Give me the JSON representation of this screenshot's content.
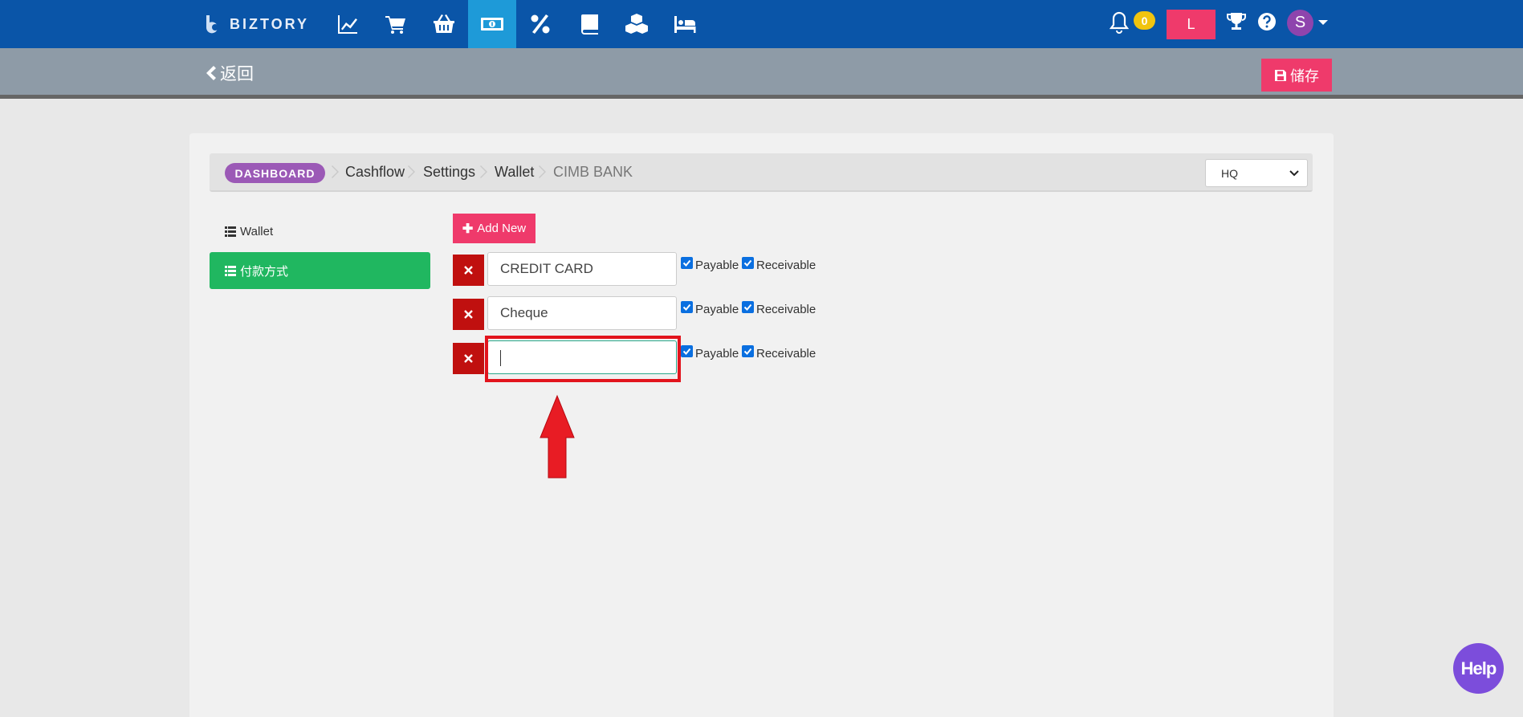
{
  "topnav": {
    "brand": "BIZTORY",
    "icons": [
      "chart-line-icon",
      "cart-icon",
      "basket-icon",
      "money-bill-icon",
      "percent-icon",
      "book-icon",
      "cubes-icon",
      "bed-icon"
    ],
    "active_icon": "money-bill-icon",
    "notification_count": "0",
    "location_button": "L",
    "avatar_letter": "S"
  },
  "subbar": {
    "back_label": "返回",
    "save_label": "储存"
  },
  "breadcrumb": {
    "dashboard": "DASHBOARD",
    "items": [
      "Cashflow",
      "Settings",
      "Wallet",
      "CIMB BANK"
    ]
  },
  "branch_select": {
    "selected": "HQ"
  },
  "sidebar": {
    "items": [
      {
        "label": "Wallet",
        "active": false
      },
      {
        "label": "付款方式",
        "active": true
      }
    ]
  },
  "main": {
    "add_new_label": "Add New",
    "payable_label": "Payable",
    "receivable_label": "Receivable",
    "methods": [
      {
        "value": "CREDIT CARD",
        "payable": true,
        "receivable": true
      },
      {
        "value": "Cheque",
        "payable": true,
        "receivable": true
      },
      {
        "value": "",
        "payable": true,
        "receivable": true,
        "focused": true
      }
    ]
  },
  "help_label": "Help",
  "colors": {
    "topnav": "#0a55a8",
    "active_tab": "#1e9ad8",
    "accent_pink": "#ef3a6b",
    "sidebar_active": "#20b760",
    "delete_red": "#c0100f",
    "dashboard_badge": "#9b59b6",
    "highlight": "#e2141d"
  }
}
